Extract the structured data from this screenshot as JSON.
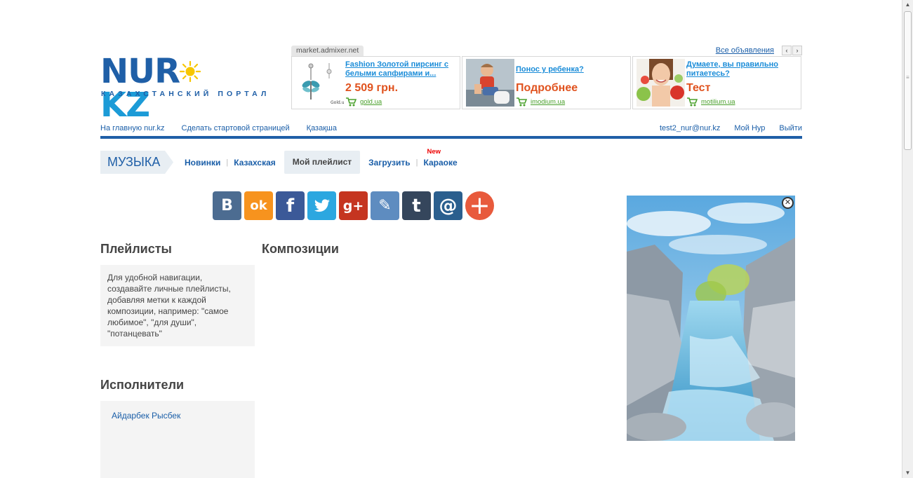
{
  "logo": {
    "name": "NUR.KZ",
    "part1": "NUR",
    "part2": "KZ",
    "tagline": "КАЗАХСТАНСКИЙ ПОРТАЛ",
    "colors": {
      "primary": "#1f5fa7",
      "secondary": "#1c9bd7",
      "sun": "#f7c600"
    }
  },
  "ads": {
    "source": "market.admixer.net",
    "all_label": "Все объявления",
    "prev": "‹",
    "next": "›",
    "items": [
      {
        "title": "Fashion Золотой пирсинг с белыми сапфирами и...",
        "price": "2 509 грн.",
        "domain": "gold.ua"
      },
      {
        "title": "Понос у ребенка?",
        "price": "Подробнее",
        "domain": "imodium.ua"
      },
      {
        "title": "Думаете, вы правильно питаетесь?",
        "price": "Тест",
        "domain": "motilium.ua"
      }
    ]
  },
  "topnav": {
    "left": [
      "На главную nur.kz",
      "Сделать стартовой страницей",
      "Қазақша"
    ],
    "user_email": "test2_nur@nur.kz",
    "my_nur": "Мой Нур",
    "logout": "Выйти"
  },
  "section": {
    "title": "МУЗЫКА",
    "menu": {
      "new_items": "Новинки",
      "kazakh": "Казахская",
      "my_playlist": "Мой плейлист",
      "upload": "Загрузить",
      "karaoke": "Караоке",
      "new_badge": "New",
      "separator": "|"
    }
  },
  "share": {
    "buttons": [
      {
        "name": "vk",
        "glyph": "В",
        "color": "#4c6c91"
      },
      {
        "name": "odnoklassniki",
        "glyph": "ok",
        "color": "#f7931e"
      },
      {
        "name": "facebook",
        "glyph": "f",
        "color": "#3b5998"
      },
      {
        "name": "twitter",
        "glyph": "t",
        "color": "#2ca7e0"
      },
      {
        "name": "google-plus",
        "glyph": "g+",
        "color": "#c53520"
      },
      {
        "name": "livejournal",
        "glyph": "✎",
        "color": "#5e8cc0"
      },
      {
        "name": "tumblr",
        "glyph": "t",
        "color": "#35465c"
      },
      {
        "name": "mail",
        "glyph": "@",
        "color": "#2b5f8e"
      },
      {
        "name": "more",
        "glyph": "+",
        "color": "#e85a3c"
      }
    ]
  },
  "playlists": {
    "heading": "Плейлисты",
    "info": "Для удобной навигации, создавайте личные плейлисты, добавляя метки к каждой композиции, например: \"самое любимое\", \"для души\", \"потанцевать\""
  },
  "compositions": {
    "heading": "Композиции"
  },
  "artists": {
    "heading": "Исполнители",
    "items": [
      "Айдарбек Рысбек"
    ]
  },
  "banner": {
    "close": "✕"
  }
}
